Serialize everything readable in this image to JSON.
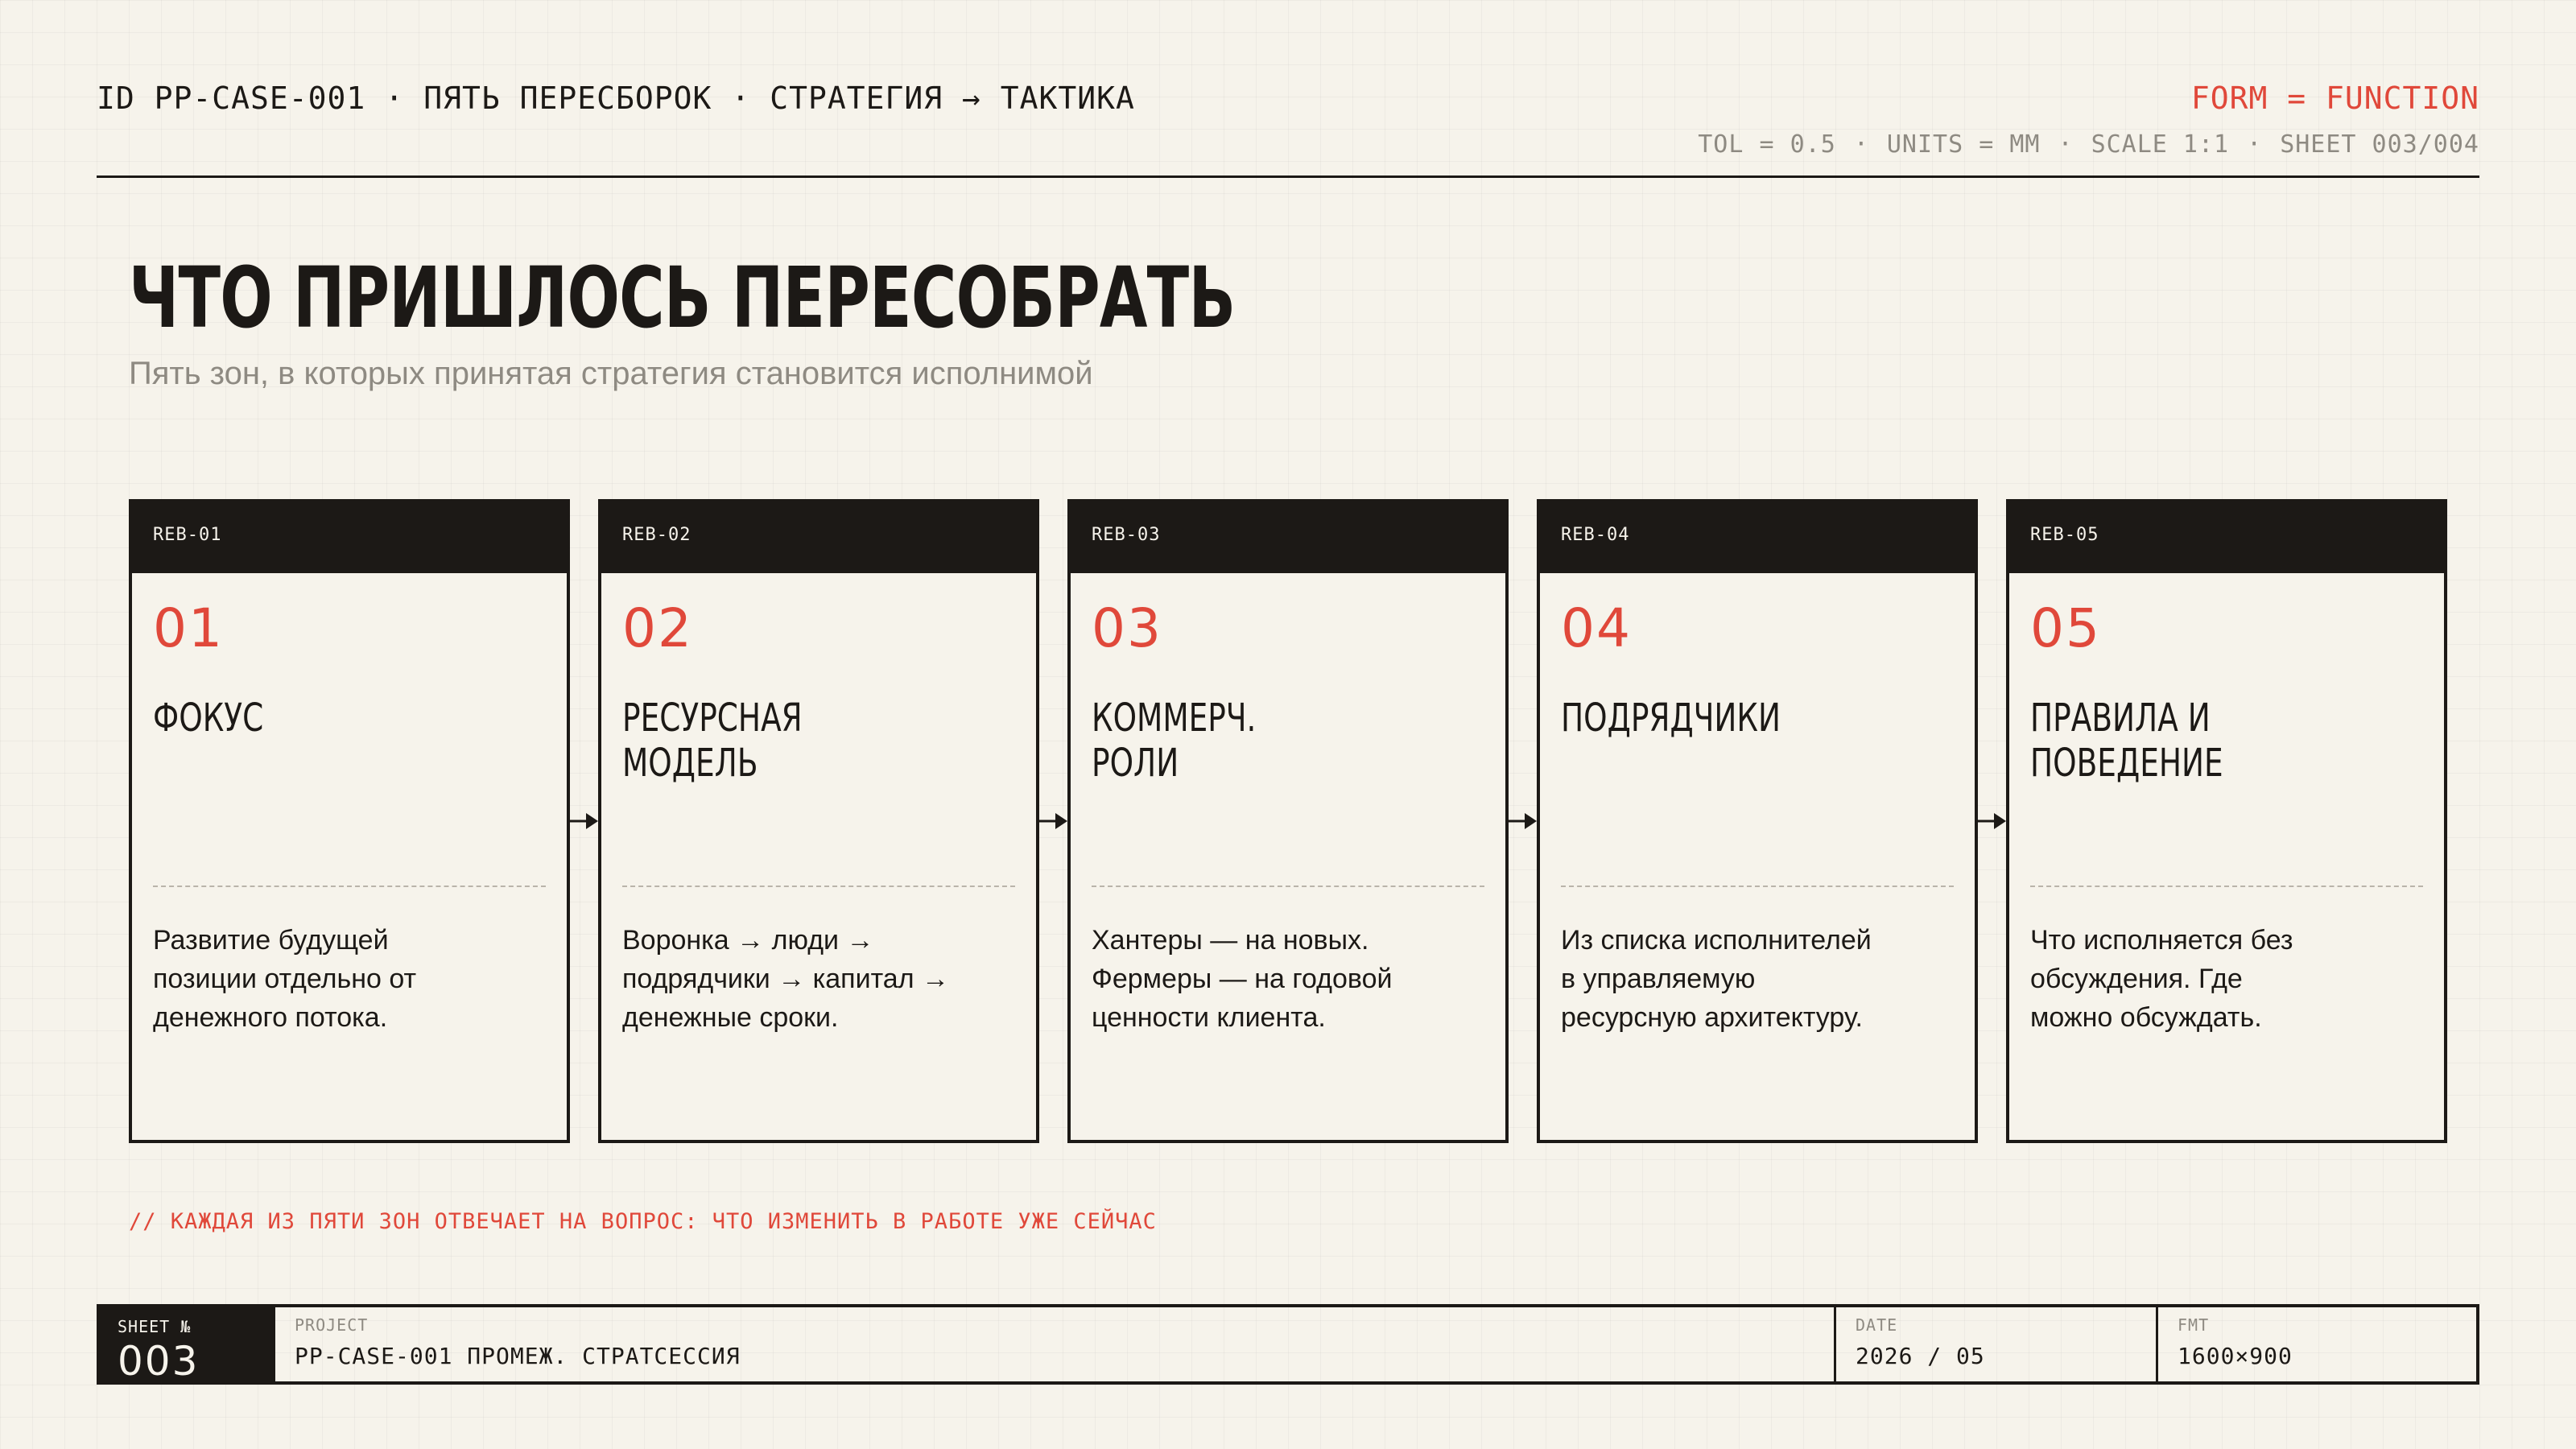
{
  "header": {
    "id_label": "ID PP-CASE-001",
    "project_label": "ПЯТЬ ПЕРЕСБОРОК",
    "flow_label": "СТРАТЕГИЯ → ТАКТИКА",
    "separator": "·",
    "motto": "FORM = FUNCTION",
    "tol": "TOL = 0.5",
    "units": "UNITS = MM",
    "scale": "SCALE 1:1",
    "sheet": "SHEET 003/004"
  },
  "title": "ЧТО ПРИШЛОСЬ ПЕРЕСОБРАТЬ",
  "subtitle": "Пять зон, в которых принятая стратегия становится исполнимой",
  "cards": [
    {
      "code": "REB-01",
      "number": "01",
      "title_lines": [
        "ФОКУС"
      ],
      "desc_lines": [
        "Развитие будущей",
        "позиции отдельно от",
        "денежного потока."
      ]
    },
    {
      "code": "REB-02",
      "number": "02",
      "title_lines": [
        "РЕСУРСНАЯ",
        "МОДЕЛЬ"
      ],
      "desc_lines": [
        "Воронка → люди →",
        "подрядчики → капитал →",
        "денежные сроки."
      ]
    },
    {
      "code": "REB-03",
      "number": "03",
      "title_lines": [
        "КОММЕРЧ.",
        "РОЛИ"
      ],
      "desc_lines": [
        "Хантеры — на новых.",
        "Фермеры — на годовой",
        "ценности клиента."
      ]
    },
    {
      "code": "REB-04",
      "number": "04",
      "title_lines": [
        "ПОДРЯДЧИКИ"
      ],
      "desc_lines": [
        "Из списка исполнителей",
        "в управляемую",
        "ресурсную архитектуру."
      ]
    },
    {
      "code": "REB-05",
      "number": "05",
      "title_lines": [
        "ПРАВИЛА И",
        "ПОВЕДЕНИЕ"
      ],
      "desc_lines": [
        "Что исполняется без",
        "обсуждения. Где",
        "можно обсуждать."
      ]
    }
  ],
  "footnote": "// КАЖДАЯ ИЗ ПЯТИ ЗОН ОТВЕЧАЕТ НА ВОПРОС: ЧТО ИЗМЕНИТЬ В РАБОТЕ УЖЕ СЕЙЧАС",
  "footer": {
    "sheet_label": "SHEET №",
    "sheet_value": "003",
    "project_label": "PROJECT",
    "project_value": "PP-CASE-001 ПРОМЕЖ. СТРАТСЕССИЯ",
    "date_label": "DATE",
    "date_value": "2026 / 05",
    "fmt_label": "FMT",
    "fmt_value": "1600×900"
  },
  "colors": {
    "background": "#f6f3eb",
    "ink": "#1c1916",
    "accent": "#e0483a",
    "muted": "#8e8a82"
  },
  "icons": {
    "connector": "arrow-right-icon"
  }
}
